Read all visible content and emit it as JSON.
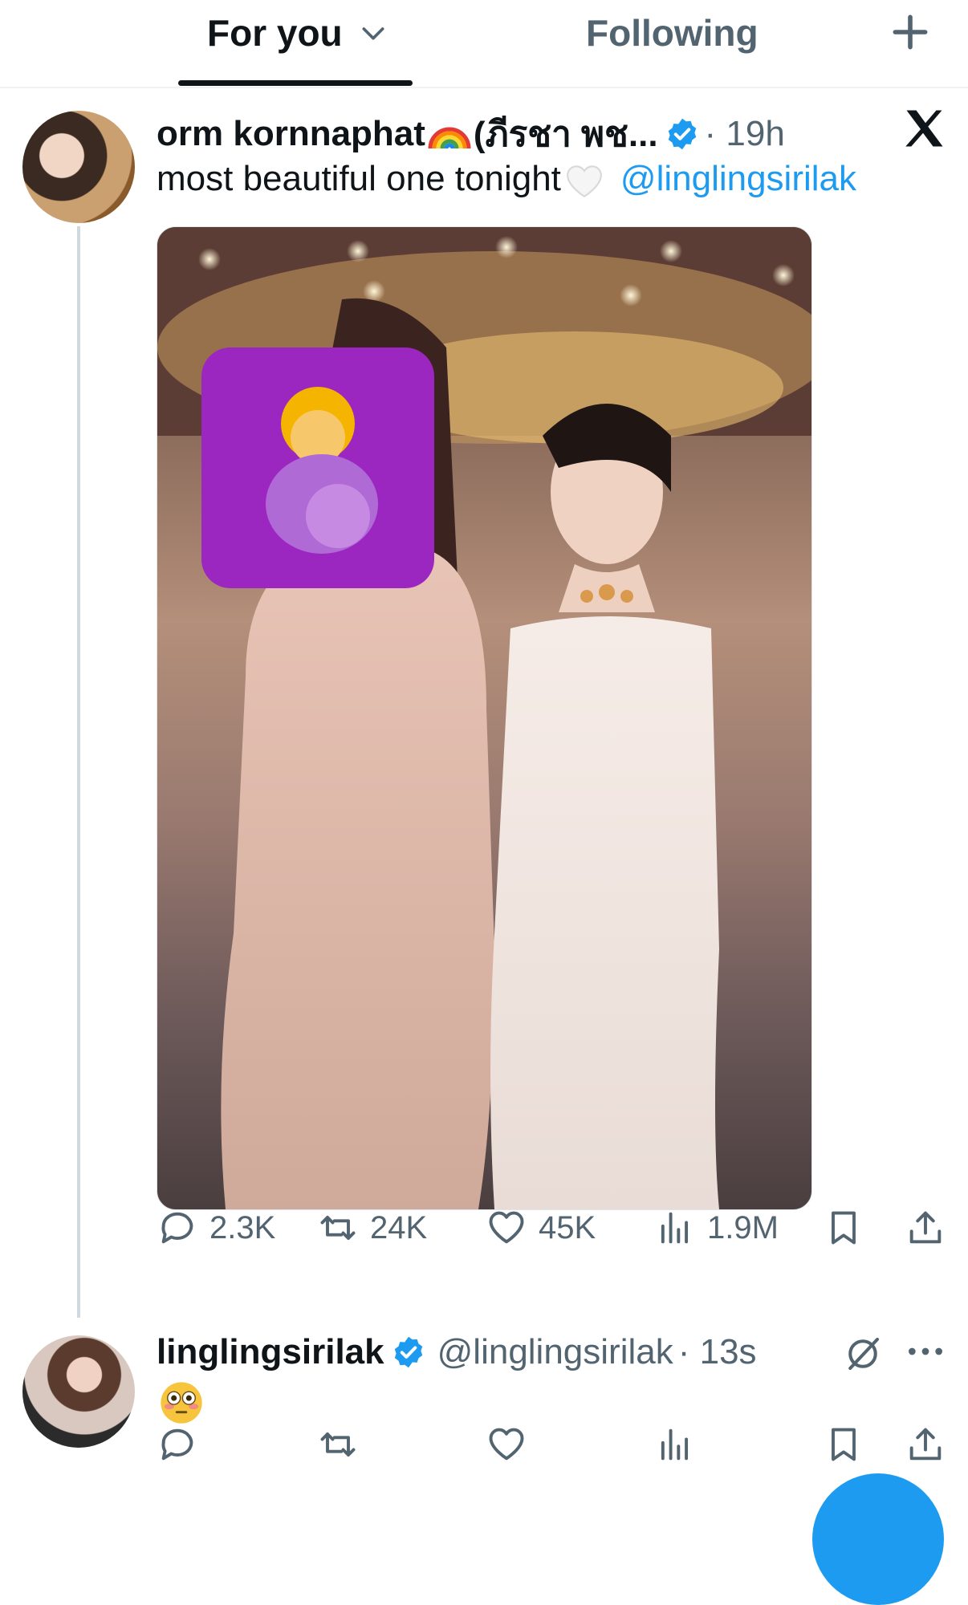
{
  "tabs": {
    "for_you": "For you",
    "following": "Following"
  },
  "tweet1": {
    "display_name": "orm kornnaphat",
    "name_suffix": "(ภีรชา พช...",
    "time": "· 19h",
    "text": "most beautiful one tonight",
    "mention": "@linglingsirilak",
    "stats": {
      "replies": "2.3K",
      "reposts": "24K",
      "likes": "45K",
      "views": "1.9M"
    }
  },
  "tweet2": {
    "display_name": "linglingsirilak",
    "handle": "@linglingsirilak",
    "time": "· 13s"
  },
  "colors": {
    "accent": "#1d9bf0",
    "muted": "#536471",
    "text": "#0f1419",
    "censor_purple": "#9b27c0"
  },
  "icons": [
    "chevron-down-icon",
    "plus-icon",
    "verified-badge-icon",
    "x-logo-icon",
    "reply-icon",
    "repost-icon",
    "like-icon",
    "views-icon",
    "bookmark-icon",
    "share-icon",
    "grok-icon",
    "more-icon"
  ]
}
